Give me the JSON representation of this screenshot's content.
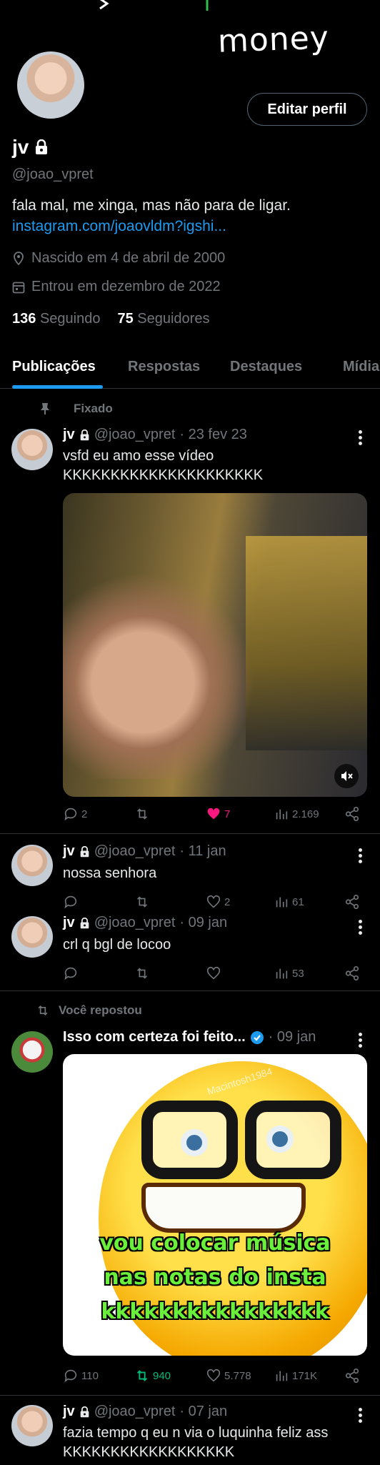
{
  "banner": {
    "text": "money"
  },
  "profile": {
    "name": "jv",
    "handle": "@joao_vpret",
    "bio": "fala mal, me xinga, mas não para de ligar.",
    "link": "instagram.com/joaovldm?igshi...",
    "birth": "Nascido em 4 de abril de 2000",
    "joined": "Entrou em dezembro de 2022",
    "following_count": "136",
    "following_label": "Seguindo",
    "followers_count": "75",
    "followers_label": "Seguidores",
    "edit_label": "Editar perfil"
  },
  "tabs": [
    "Publicações",
    "Respostas",
    "Destaques",
    "Mídia"
  ],
  "pinned_label": "Fixado",
  "reposted_label": "Você repostou",
  "tweets": [
    {
      "name": "jv",
      "handle": "@joao_vpret",
      "date": "· 23 fev 23",
      "text1": "vsfd eu amo esse vídeo",
      "text2": "KKKKKKKKKKKKKKKKKKKKK",
      "replies": "2",
      "retweets": "",
      "likes": "7",
      "views": "2.169"
    },
    {
      "name": "jv",
      "handle": "@joao_vpret",
      "date": "· 11 jan",
      "text1": "nossa senhora",
      "replies": "",
      "retweets": "",
      "likes": "2",
      "views": "61"
    },
    {
      "name": "jv",
      "handle": "@joao_vpret",
      "date": "· 09 jan",
      "text1": "crl q bgl de locoo",
      "replies": "",
      "retweets": "",
      "likes": "",
      "views": "53"
    },
    {
      "name": "Isso com certeza foi feito...",
      "handle": "",
      "date": "· 09 jan",
      "replies": "110",
      "retweets": "940",
      "likes": "5.778",
      "views": "171K",
      "meme_watermark": "Macintosh1984",
      "meme_line1": "vou colocar música",
      "meme_line2": "nas notas do insta",
      "meme_line3": "kkkkkkkkkkkkkkkk"
    },
    {
      "name": "jv",
      "handle": "@joao_vpret",
      "date": "· 07 jan",
      "text1": "fazia tempo q eu n via o luquinha feliz ass",
      "text2": "KKKKKKKKKKKKKKKKKK"
    }
  ],
  "colors": {
    "accent": "#1d9bf0",
    "like": "#f91880",
    "retweet": "#00ba7c",
    "muted": "#71767b"
  }
}
